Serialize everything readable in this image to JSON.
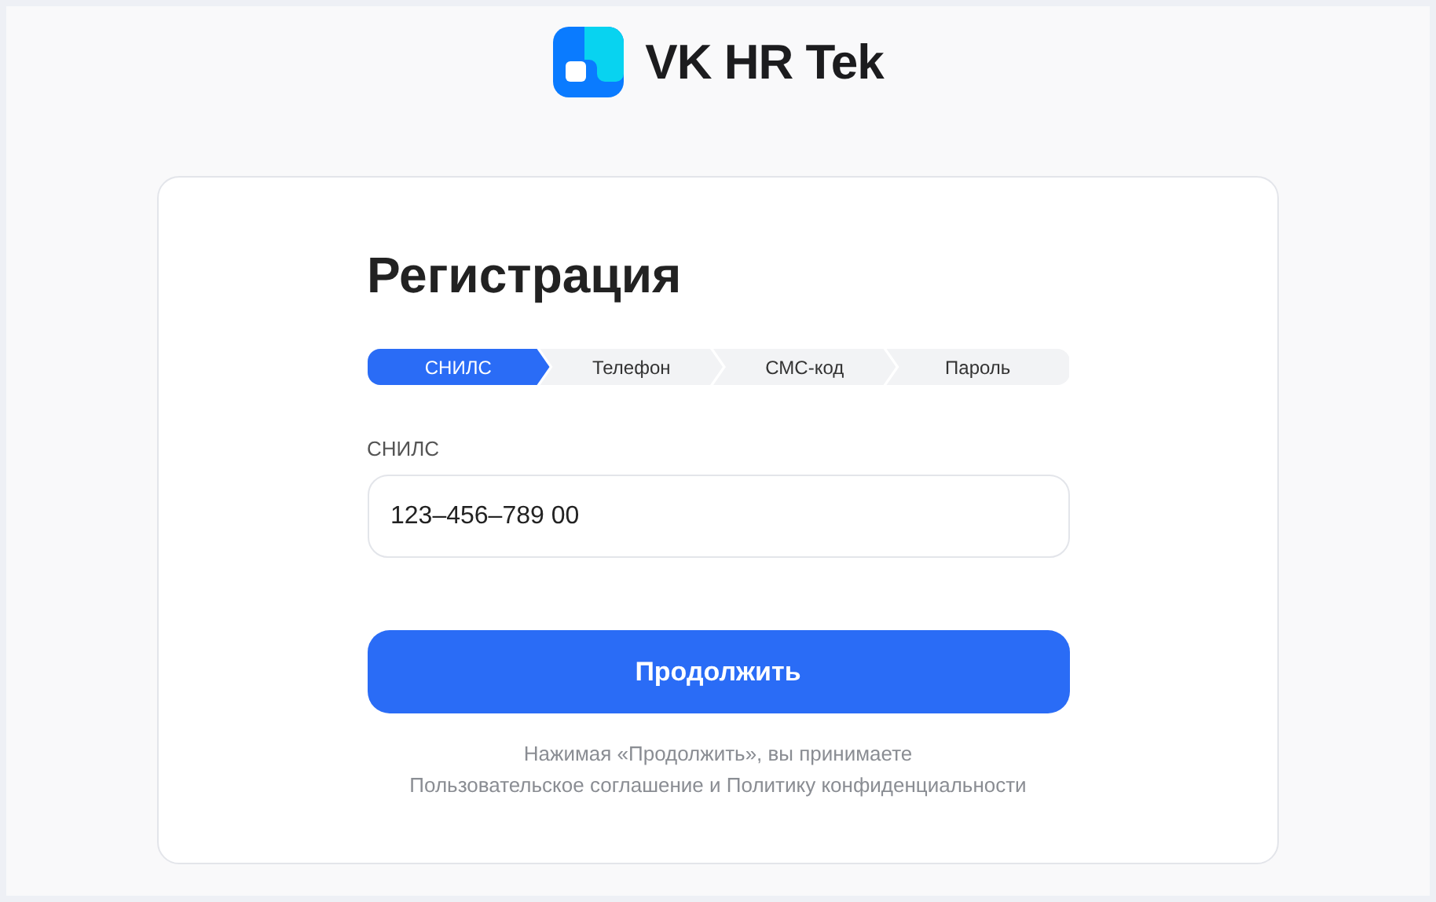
{
  "brand": {
    "name": "VK HR Tek"
  },
  "form": {
    "title": "Регистрация",
    "steps": [
      {
        "label": "СНИЛС",
        "selected": true
      },
      {
        "label": "Телефон",
        "selected": false
      },
      {
        "label": "СМС-код",
        "selected": false
      },
      {
        "label": "Пароль",
        "selected": false
      }
    ],
    "field": {
      "label": "СНИЛС",
      "value": "123–456–789 00"
    },
    "button": "Продолжить",
    "notice_lines": [
      "Нажимая «Продолжить», вы принимаете",
      "Пользовательское соглашение и Политику конфиденциальности"
    ]
  }
}
